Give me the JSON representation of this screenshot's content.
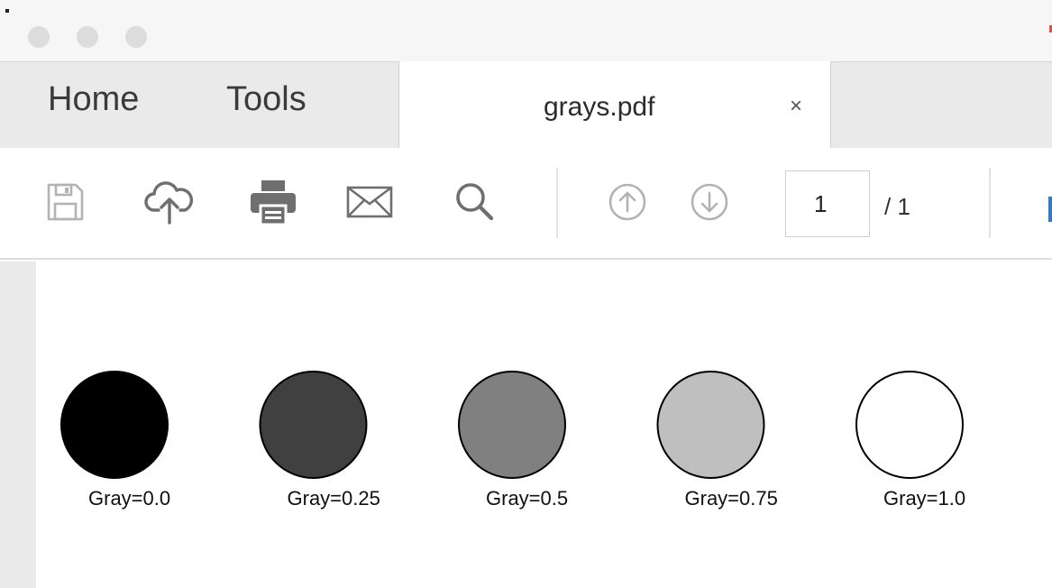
{
  "window": {
    "traffic_lights": [
      "close",
      "minimize",
      "zoom"
    ]
  },
  "tabs": {
    "home_label": "Home",
    "tools_label": "Tools",
    "document": {
      "title": "grays.pdf",
      "close_glyph": "×"
    }
  },
  "toolbar": {
    "icons": [
      "save-icon",
      "cloud-upload-icon",
      "print-icon",
      "email-icon",
      "search-icon",
      "previous-page-icon",
      "next-page-icon"
    ],
    "page_number": "1",
    "page_total": "/ 1"
  },
  "document": {
    "swatches": [
      {
        "label": "Gray=0.0",
        "gray": 0.0,
        "fill": "#000000"
      },
      {
        "label": "Gray=0.25",
        "gray": 0.25,
        "fill": "#404040"
      },
      {
        "label": "Gray=0.5",
        "gray": 0.5,
        "fill": "#808080"
      },
      {
        "label": "Gray=0.75",
        "gray": 0.75,
        "fill": "#bfbfbf"
      },
      {
        "label": "Gray=1.0",
        "gray": 1.0,
        "fill": "#ffffff"
      }
    ]
  },
  "colors": {
    "accent": "#2a7ad5",
    "tab_bar": "#eaeaea",
    "icon": "#6f6f6f"
  }
}
